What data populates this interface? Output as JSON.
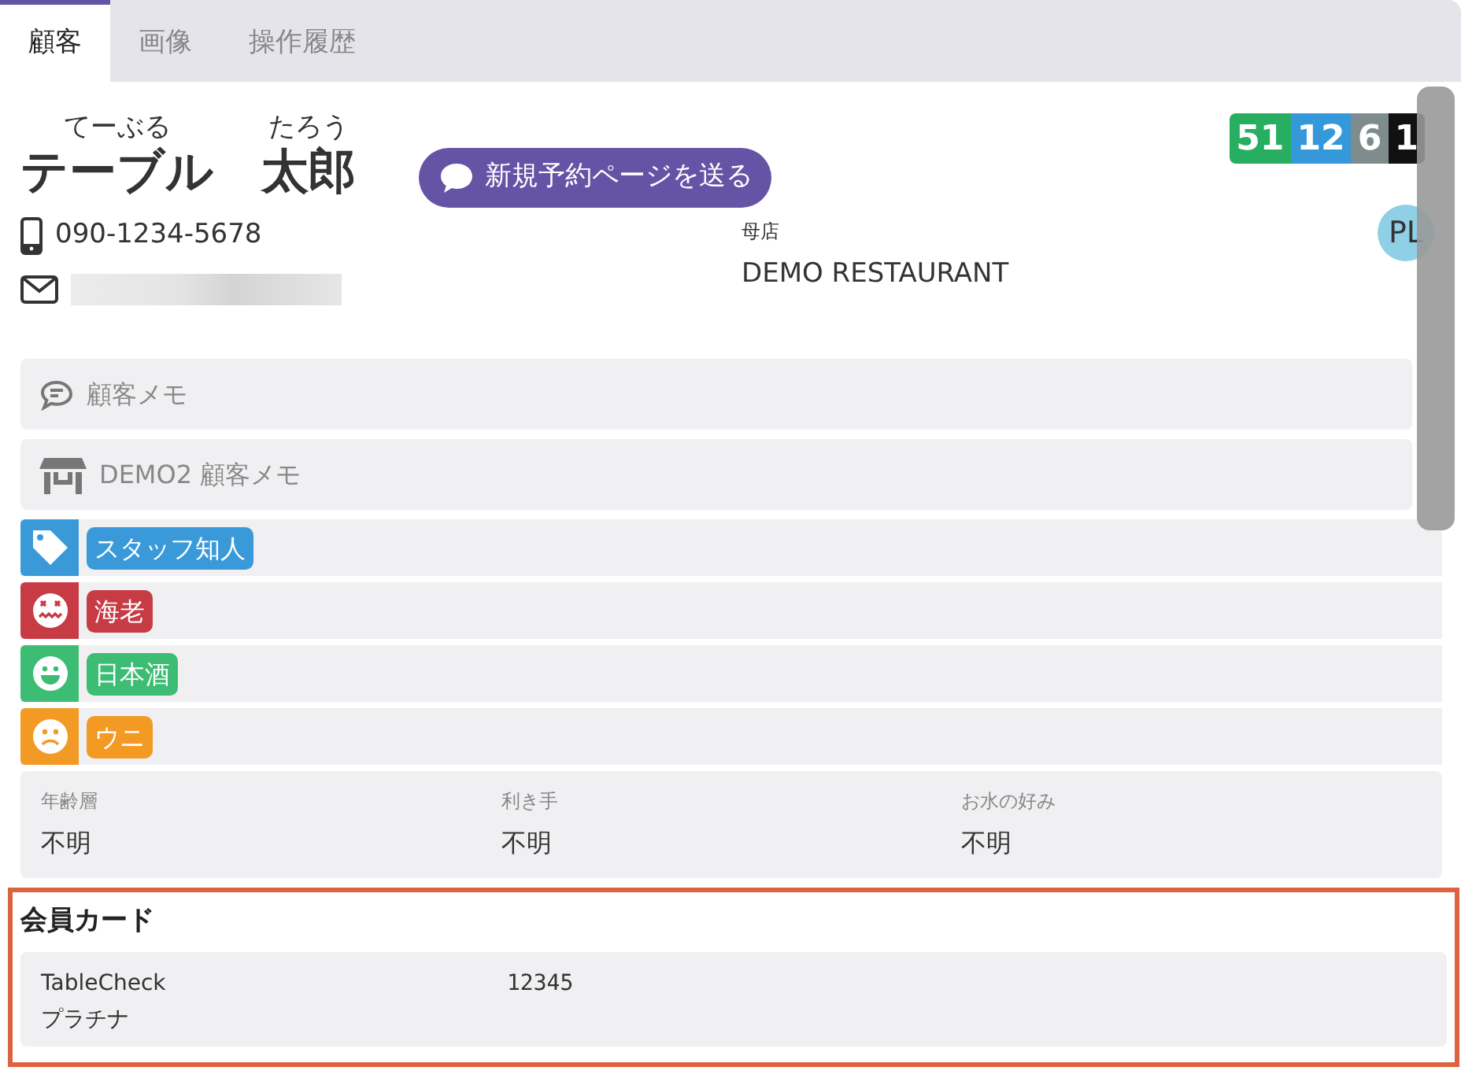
{
  "tabs": [
    {
      "label": "顧客",
      "selected": true
    },
    {
      "label": "画像",
      "selected": false
    },
    {
      "label": "操作履歴",
      "selected": false
    }
  ],
  "customer": {
    "last_name_kana": "てーぶる",
    "first_name_kana": "たろう",
    "last_name": "テーブル",
    "first_name": "太郎",
    "phone": "090-1234-5678",
    "email_redacted": true,
    "home_store_label": "母店",
    "home_store": "DEMO RESTAURANT",
    "avatar": "PL"
  },
  "send_button": "新規予約ページを送る",
  "stats": [
    {
      "value": "51",
      "color": "#27ae60"
    },
    {
      "value": "12",
      "color": "#3498db"
    },
    {
      "value": "6",
      "color": "#7f8c8d"
    },
    {
      "value": "1",
      "color": "#111111"
    }
  ],
  "memos": [
    {
      "kind": "chat",
      "label": "顧客メモ"
    },
    {
      "kind": "store",
      "label": "DEMO2 顧客メモ"
    }
  ],
  "tags": [
    {
      "kind": "tag",
      "label": "スタッフ知人",
      "color": "#3a9ad9"
    },
    {
      "kind": "dislike",
      "label": "海老",
      "color": "#c73b45"
    },
    {
      "kind": "like",
      "label": "日本酒",
      "color": "#3dbd73"
    },
    {
      "kind": "sad",
      "label": "ウニ",
      "color": "#f39a24"
    }
  ],
  "attributes": [
    {
      "label": "年齢層",
      "value": "不明"
    },
    {
      "label": "利き手",
      "value": "不明"
    },
    {
      "label": "お水の好み",
      "value": "不明"
    }
  ],
  "member_cards": {
    "title": "会員カード",
    "cards": [
      {
        "brand": "TableCheck",
        "rank": "プラチナ",
        "number": "12345"
      }
    ]
  }
}
